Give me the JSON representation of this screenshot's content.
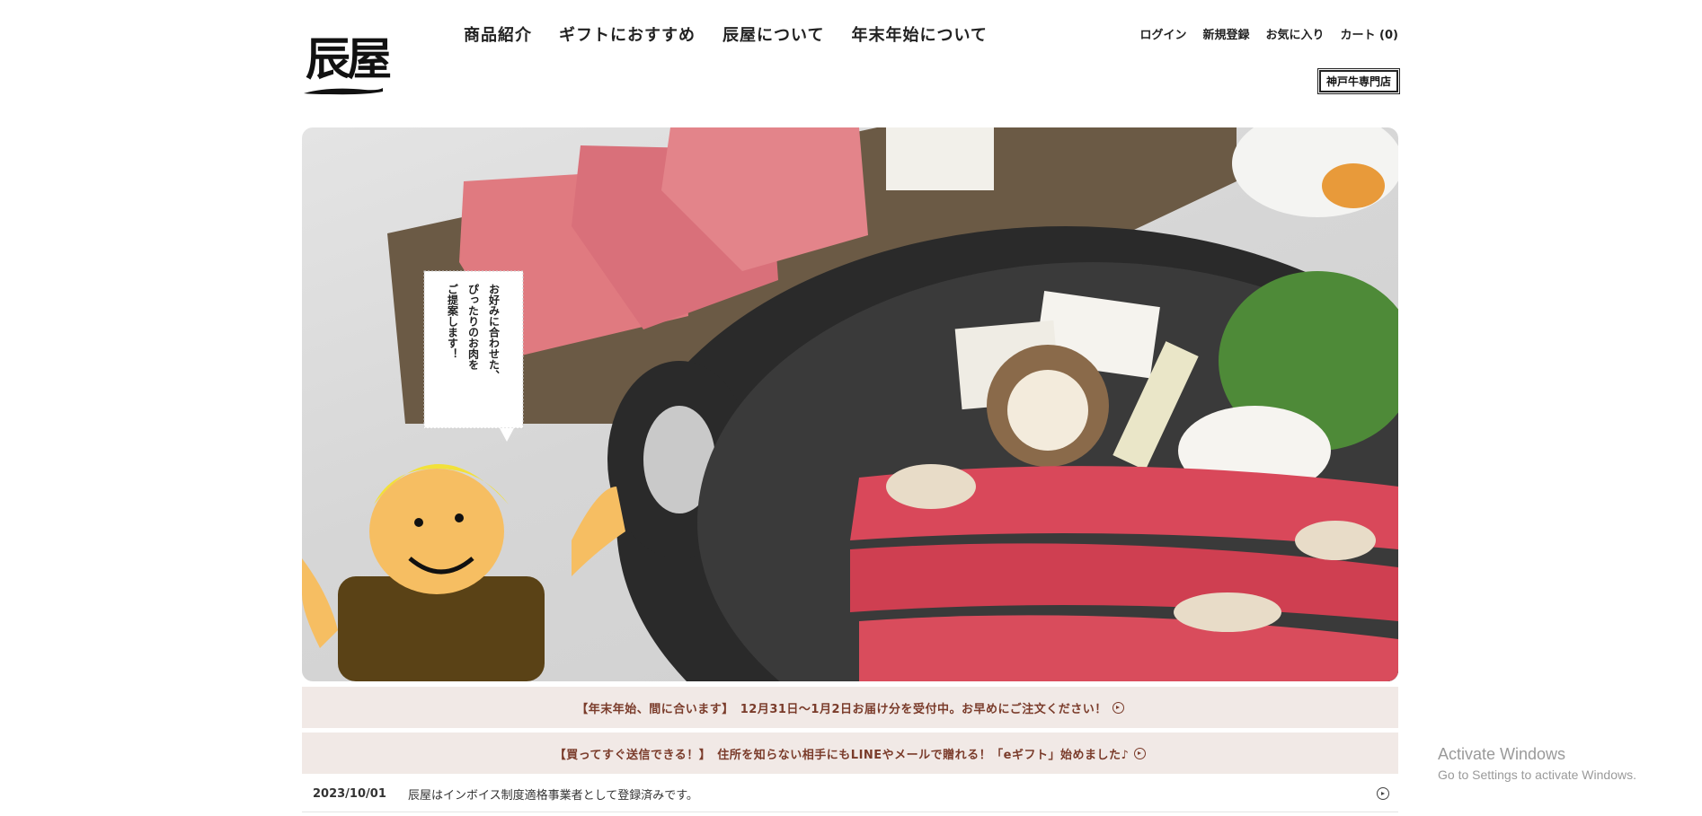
{
  "brand": {
    "logo_text": "辰屋",
    "logo_small": "辰"
  },
  "main_nav": [
    {
      "label": "商品紹介"
    },
    {
      "label": "ギフトにおすすめ"
    },
    {
      "label": "辰屋について"
    },
    {
      "label": "年末年始について"
    }
  ],
  "util_nav": {
    "login": "ログイン",
    "register": "新規登録",
    "favorites": "お気に入り",
    "cart": "カート (0)"
  },
  "shop_badge": "神戸牛専門店",
  "hero": {
    "bubble_lines": [
      "お好みに合わせた、",
      "ぴったりのお肉を",
      "ご提案します！"
    ]
  },
  "notices": [
    {
      "text": "【年末年始、間に合います】　12月31日〜1月2日お届け分を受付中。お早めにご注文ください！"
    },
    {
      "text": "【買ってすぐ送信できる！】　住所を知らない相手にもLINEやメールで贈れる！「eギフト」始めました♪"
    }
  ],
  "news": [
    {
      "date": "2023/10/01",
      "text": "辰屋はインボイス制度適格事業者として登録済みです。"
    }
  ],
  "watermark": {
    "title": "Activate Windows",
    "subtitle": "Go to Settings to activate Windows."
  },
  "colors": {
    "notice_bg": "#f1e9e6",
    "notice_text": "#7a3b2a",
    "meat_red": "#d9485a",
    "pot_black": "#2a2a2a"
  }
}
